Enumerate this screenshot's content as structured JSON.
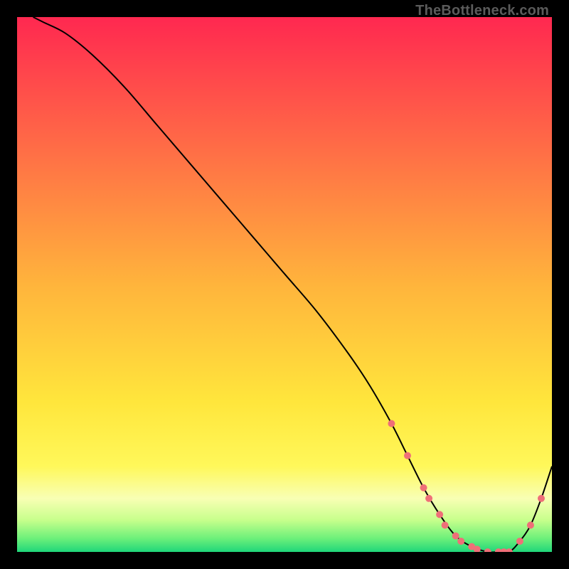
{
  "watermark": "TheBottleneck.com",
  "chart_data": {
    "type": "line",
    "title": "",
    "xlabel": "",
    "ylabel": "",
    "xlim": [
      0,
      100
    ],
    "ylim": [
      0,
      100
    ],
    "grid": false,
    "legend": false,
    "background_gradient": {
      "stops": [
        {
          "offset": 0.0,
          "color": "#ff2850"
        },
        {
          "offset": 0.5,
          "color": "#ffb43c"
        },
        {
          "offset": 0.72,
          "color": "#ffe63c"
        },
        {
          "offset": 0.84,
          "color": "#fff85a"
        },
        {
          "offset": 0.9,
          "color": "#f8ffb4"
        },
        {
          "offset": 0.94,
          "color": "#c8ff8c"
        },
        {
          "offset": 0.975,
          "color": "#6cf07a"
        },
        {
          "offset": 1.0,
          "color": "#1fd67a"
        }
      ]
    },
    "series": [
      {
        "name": "bottleneck-curve",
        "color": "#000000",
        "width": 2,
        "x": [
          3,
          5,
          9,
          14,
          20,
          26,
          32,
          38,
          44,
          50,
          56,
          62,
          66,
          70,
          73,
          76,
          79,
          82,
          85,
          88,
          90,
          92,
          94,
          96,
          98,
          100
        ],
        "y": [
          100,
          99,
          97,
          93,
          87,
          80,
          73,
          66,
          59,
          52,
          45,
          37,
          31,
          24,
          18,
          12,
          7,
          3,
          1,
          0,
          0,
          0,
          2,
          5,
          10,
          16
        ]
      },
      {
        "name": "highlight-markers",
        "color": "#ef6f78",
        "marker_radius": 5,
        "x": [
          70,
          73,
          76,
          77,
          79,
          80,
          82,
          83,
          85,
          86,
          88,
          90,
          91,
          92,
          94,
          96,
          98
        ],
        "y": [
          24,
          18,
          12,
          10,
          7,
          5,
          3,
          2,
          1,
          0.5,
          0,
          0,
          0,
          0,
          2,
          5,
          10
        ]
      }
    ]
  }
}
